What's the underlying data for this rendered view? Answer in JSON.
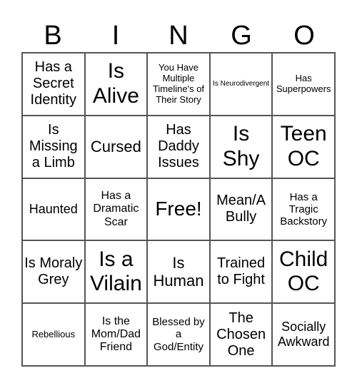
{
  "header": [
    "B",
    "I",
    "N",
    "G",
    "O"
  ],
  "cells": [
    "Has a Secret Identity",
    "Is Alive",
    "You Have Multiple Timeline's of Their Story",
    "Is Neurodivergent",
    "Has Superpowers",
    "Is Missing a Limb",
    "Cursed",
    "Has Daddy Issues",
    "Is Shy",
    "Teen OC",
    "Haunted",
    "Has a Dramatic Scar",
    "Free!",
    "Mean/A Bully",
    "Has a Tragic Backstory",
    "Is Moraly Grey",
    "Is a Vilain",
    "Is Human",
    "Trained to Fight",
    "Child OC",
    "Rebellious",
    "Is the Mom/Dad Friend",
    "Blessed by a God/Entity",
    "The Chosen One",
    "Socially Awkward"
  ]
}
